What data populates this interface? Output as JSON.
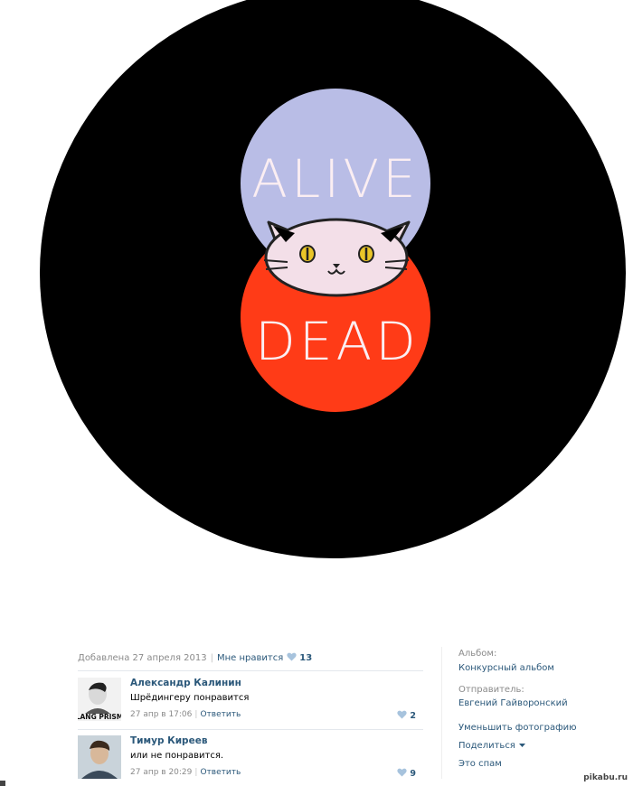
{
  "image": {
    "text_top": "ALIVE",
    "text_bottom": "DEAD",
    "colors": {
      "disc": "#000000",
      "top_circle": "#b9bde6",
      "bottom_circle": "#ff3b17",
      "cat": "#f3dfe8"
    }
  },
  "meta": {
    "added": "Добавлена 27 апреля 2013",
    "like_label": "Мне нравится",
    "like_count": "13"
  },
  "comments": [
    {
      "name": "Александр Калинин",
      "text": "Шрёдингеру понравится",
      "time": "27 апр в 17:06",
      "reply": "Ответить",
      "likes": "2",
      "avatar_text": "LANG PRISM"
    },
    {
      "name": "Тимур Киреев",
      "text": "или не понравится.",
      "time": "27 апр в 20:29",
      "reply": "Ответить",
      "likes": "9"
    }
  ],
  "sidebar": {
    "album_label": "Альбом:",
    "album_value": "Конкурсный альбом",
    "sender_label": "Отправитель:",
    "sender_value": "Евгений Гайворонский",
    "shrink": "Уменьшить фотографию",
    "share": "Поделиться",
    "spam": "Это спам"
  },
  "watermark": "pikabu.ru"
}
